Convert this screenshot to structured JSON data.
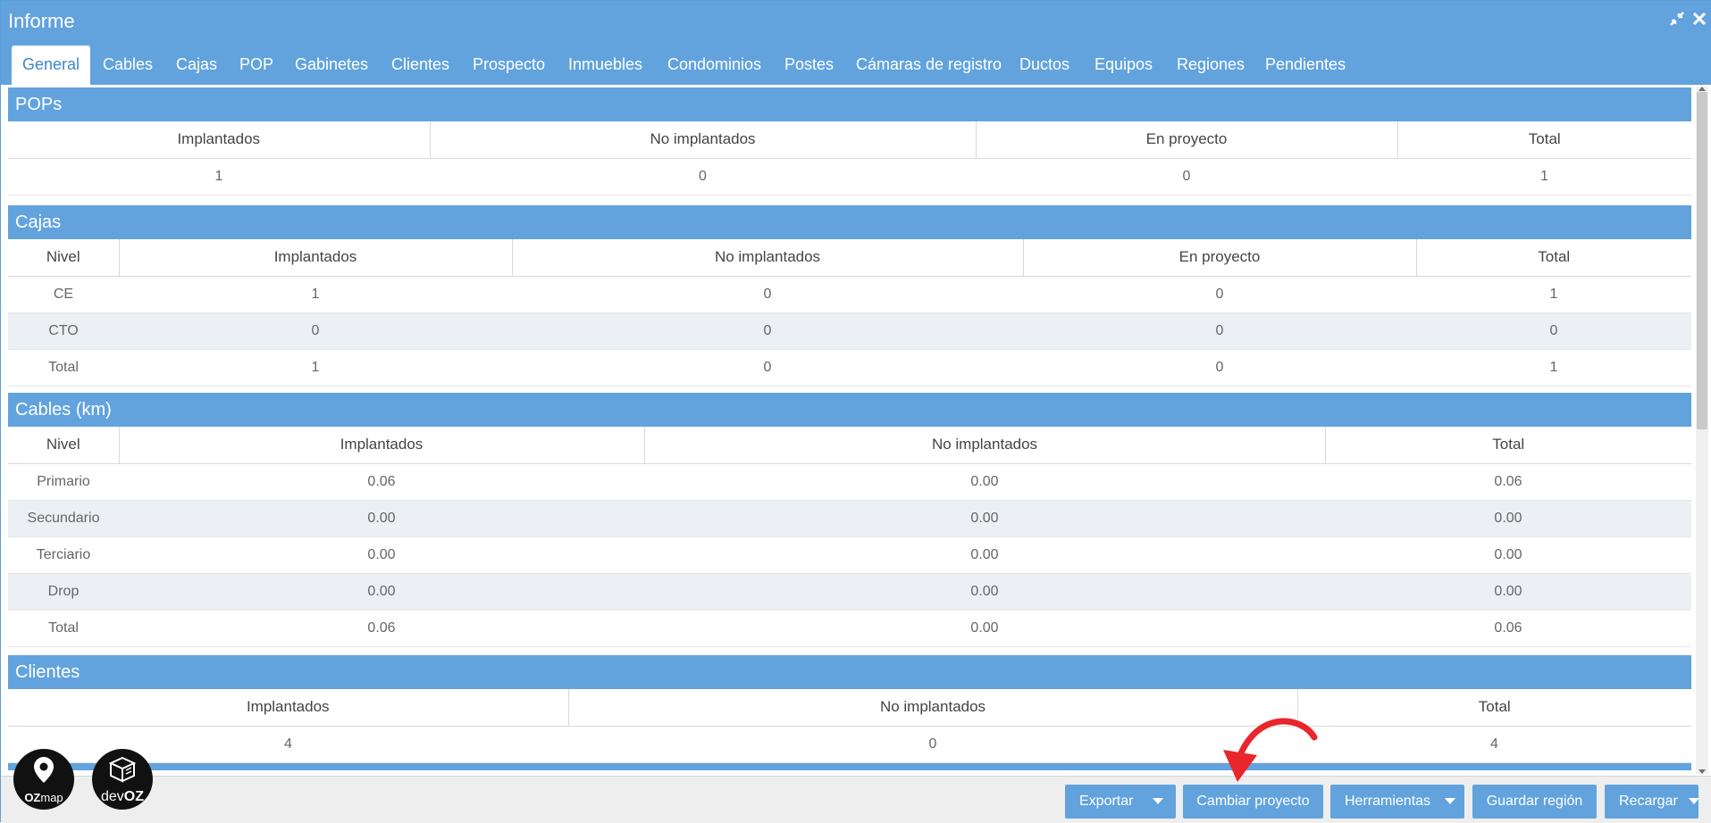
{
  "window": {
    "title": "Informe"
  },
  "tabs": [
    "General",
    "Cables",
    "Cajas",
    "POP",
    "Gabinetes",
    "Clientes",
    "Prospecto",
    "Inmuebles",
    "Condominios",
    "Postes",
    "Cámaras de registro",
    "Ductos",
    "Equipos",
    "Regiones",
    "Pendientes"
  ],
  "pops": {
    "title": "POPs",
    "headers": [
      "Implantados",
      "No implantados",
      "En proyecto",
      "Total"
    ],
    "row": [
      "1",
      "0",
      "0",
      "1"
    ]
  },
  "cajas": {
    "title": "Cajas",
    "headers": [
      "Nivel",
      "Implantados",
      "No implantados",
      "En proyecto",
      "Total"
    ],
    "rows": [
      [
        "CE",
        "1",
        "0",
        "0",
        "1"
      ],
      [
        "CTO",
        "0",
        "0",
        "0",
        "0"
      ],
      [
        "Total",
        "1",
        "0",
        "0",
        "1"
      ]
    ]
  },
  "cables": {
    "title": "Cables (km)",
    "headers": [
      "Nivel",
      "Implantados",
      "No implantados",
      "Total"
    ],
    "rows": [
      [
        "Primario",
        "0.06",
        "0.00",
        "0.06"
      ],
      [
        "Secundario",
        "0.00",
        "0.00",
        "0.00"
      ],
      [
        "Terciario",
        "0.00",
        "0.00",
        "0.00"
      ],
      [
        "Drop",
        "0.00",
        "0.00",
        "0.00"
      ],
      [
        "Total",
        "0.06",
        "0.00",
        "0.06"
      ]
    ]
  },
  "clientes": {
    "title": "Clientes",
    "headers": [
      "Implantados",
      "No implantados",
      "Total"
    ],
    "row": [
      "4",
      "0",
      "4"
    ]
  },
  "footer": {
    "exportar": "Exportar",
    "cambiar_proyecto": "Cambiar proyecto",
    "herramientas": "Herramientas",
    "guardar_region": "Guardar región",
    "recargar": "Recargar"
  },
  "logos": {
    "ozmap_prefix": "OZ",
    "ozmap_suffix": "map",
    "devoz_prefix": "dev",
    "devoz_suffix": "OZ"
  },
  "colors": {
    "accent": "#62a3de",
    "annotation_arrow": "#e8262b"
  },
  "icons": {
    "minimize": "compress-icon",
    "close": "close-icon",
    "dropdown": "caret-down-icon",
    "ozmap": "map-pin-icon",
    "devoz": "cube-icon"
  }
}
